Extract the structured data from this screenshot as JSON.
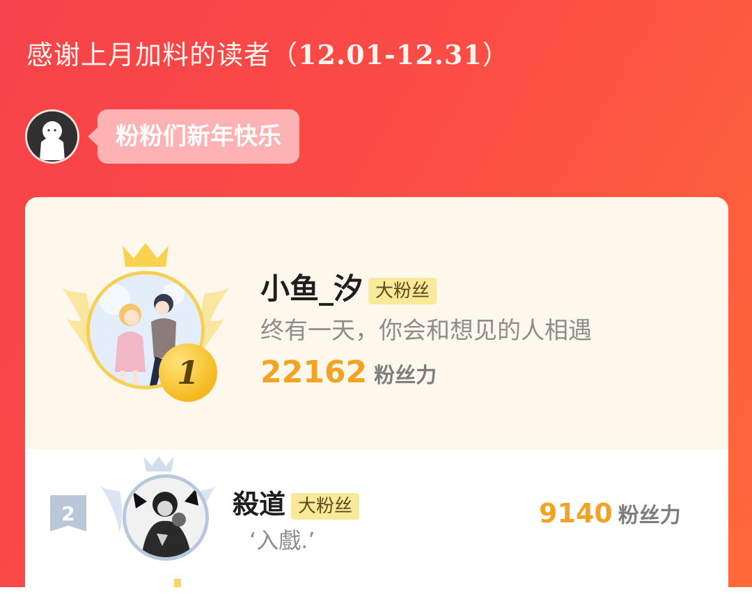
{
  "header": {
    "title_prefix": "感谢上月加料的读者",
    "date_open": "（",
    "date_range": "12.01-12.31",
    "date_close": "）"
  },
  "message": {
    "text": "粉粉们新年快乐"
  },
  "ranking": [
    {
      "rank": "1",
      "name": "小鱼_汐",
      "tag": "大粉丝",
      "motto": "终有一天，你会和想见的人相遇",
      "score": "22162",
      "score_unit": "粉丝力"
    },
    {
      "rank": "2",
      "name": "殺道",
      "tag": "大粉丝",
      "motto": "‘入戲.’",
      "score": "9140",
      "score_unit": "粉丝力"
    }
  ],
  "colors": {
    "accent_red": "#f6424a",
    "gold": "#f2a324",
    "silver": "#b9c7d8",
    "tag_bg": "#fbe99a"
  }
}
